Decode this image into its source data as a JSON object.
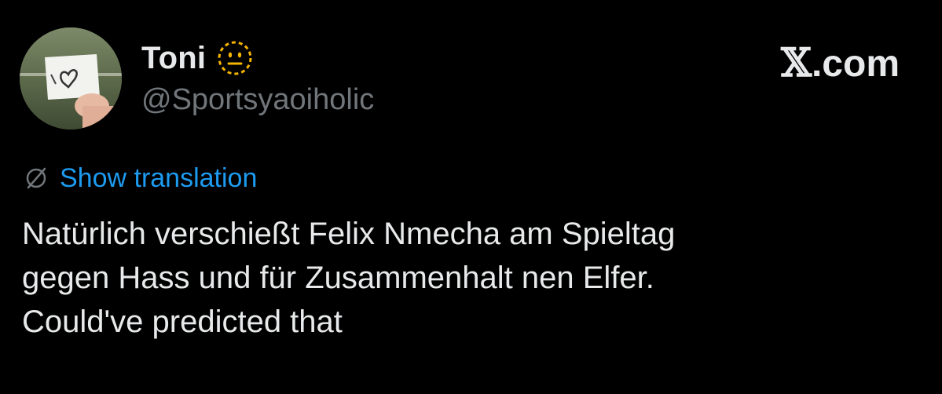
{
  "author": {
    "display_name": "Toni",
    "handle": "@Sportsyaoiholic",
    "badge_icon": "dotted-neutral-face-emoji-icon",
    "avatar": "avatar-hand-holding-heart-note"
  },
  "site": {
    "logo_text": ".com",
    "logo_glyph": "𝕏"
  },
  "translation": {
    "icon": "globe-slash-icon",
    "label": "Show translation"
  },
  "tweet": {
    "lines": [
      "Natürlich verschießt Felix Nmecha am Spieltag",
      "gegen Hass und für Zusammenhalt nen Elfer.",
      "Could've predicted that"
    ]
  },
  "colors": {
    "background": "#000000",
    "text": "#e7e9ea",
    "muted": "#71767b",
    "link": "#1d9bf0",
    "emoji": "#f4b400"
  }
}
